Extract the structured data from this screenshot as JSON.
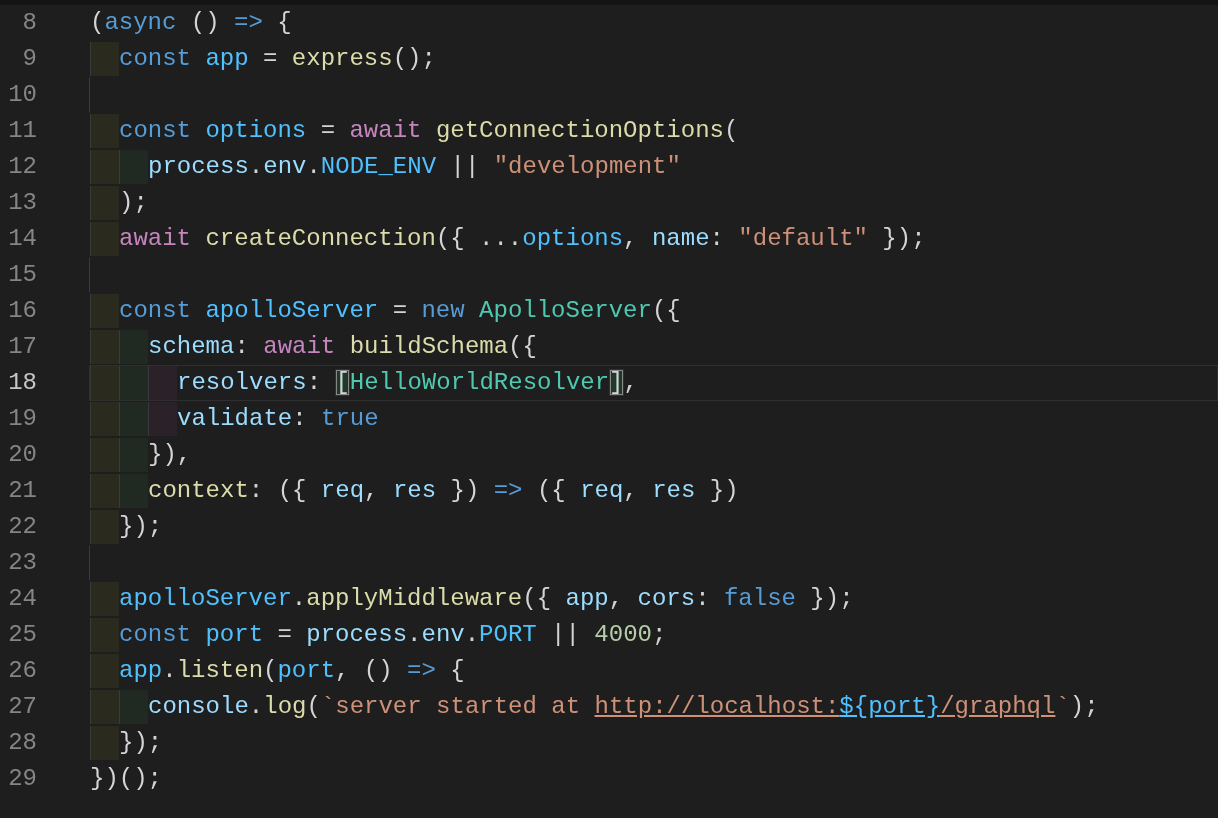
{
  "lines": [
    {
      "number": "8",
      "current": false,
      "tokens": [
        {
          "kind": "p",
          "text": "("
        },
        {
          "kind": "kw",
          "text": "async"
        },
        {
          "kind": "p",
          "text": " () "
        },
        {
          "kind": "kw",
          "text": "=>"
        },
        {
          "kind": "p",
          "text": " {"
        }
      ]
    },
    {
      "number": "9",
      "current": false,
      "tokens": [
        {
          "kind": "kw",
          "text": "  const "
        },
        {
          "kind": "const",
          "text": "app"
        },
        {
          "kind": "p",
          "text": " = "
        },
        {
          "kind": "fn",
          "text": "express"
        },
        {
          "kind": "p",
          "text": "();"
        }
      ]
    },
    {
      "number": "10",
      "current": false
    },
    {
      "number": "11",
      "current": false,
      "tokens": [
        {
          "kind": "kw",
          "text": "  const "
        },
        {
          "kind": "const",
          "text": "options"
        },
        {
          "kind": "p",
          "text": " = "
        },
        {
          "kind": "await",
          "text": "await "
        },
        {
          "kind": "fn",
          "text": "getConnectionOptions"
        },
        {
          "kind": "p",
          "text": "("
        }
      ]
    },
    {
      "number": "12",
      "current": false,
      "tokens": [
        {
          "kind": "var",
          "text": "    process"
        },
        {
          "kind": "p",
          "text": "."
        },
        {
          "kind": "var",
          "text": "env"
        },
        {
          "kind": "p",
          "text": "."
        },
        {
          "kind": "const",
          "text": "NODE_ENV"
        },
        {
          "kind": "p",
          "text": " || "
        },
        {
          "kind": "str",
          "text": "\"development\""
        }
      ]
    },
    {
      "number": "13",
      "current": false,
      "tokens": [
        {
          "kind": "p",
          "text": "  );"
        }
      ]
    },
    {
      "number": "14",
      "current": false,
      "tokens": [
        {
          "kind": "await",
          "text": "  await "
        },
        {
          "kind": "fn",
          "text": "createConnection"
        },
        {
          "kind": "p",
          "text": "({ ..."
        },
        {
          "kind": "const",
          "text": "options"
        },
        {
          "kind": "p",
          "text": ", "
        },
        {
          "kind": "var",
          "text": "name"
        },
        {
          "kind": "p",
          "text": ": "
        },
        {
          "kind": "str",
          "text": "\"default\""
        },
        {
          "kind": "p",
          "text": " });"
        }
      ]
    },
    {
      "number": "15",
      "current": false
    },
    {
      "number": "16",
      "current": false,
      "tokens": [
        {
          "kind": "kw",
          "text": "  const "
        },
        {
          "kind": "const",
          "text": "apolloServer"
        },
        {
          "kind": "p",
          "text": " = "
        },
        {
          "kind": "kw",
          "text": "new "
        },
        {
          "kind": "cls",
          "text": "ApolloServer"
        },
        {
          "kind": "p",
          "text": "({"
        }
      ]
    },
    {
      "number": "17",
      "current": false,
      "tokens": [
        {
          "kind": "var",
          "text": "    schema"
        },
        {
          "kind": "p",
          "text": ": "
        },
        {
          "kind": "await",
          "text": "await "
        },
        {
          "kind": "fn",
          "text": "buildSchema"
        },
        {
          "kind": "p",
          "text": "({"
        }
      ]
    },
    {
      "number": "18",
      "current": true,
      "tokens": [
        {
          "kind": "var",
          "text": "      resolvers"
        },
        {
          "kind": "p",
          "text": ": "
        },
        {
          "kind": "match",
          "text": "["
        },
        {
          "kind": "cls",
          "text": "HelloWorldResolver"
        },
        {
          "kind": "match",
          "text": "]"
        },
        {
          "kind": "p",
          "text": ","
        }
      ]
    },
    {
      "number": "19",
      "current": false,
      "tokens": [
        {
          "kind": "var",
          "text": "      validate"
        },
        {
          "kind": "p",
          "text": ": "
        },
        {
          "kind": "kw",
          "text": "true"
        }
      ]
    },
    {
      "number": "20",
      "current": false,
      "tokens": [
        {
          "kind": "p",
          "text": "    }),"
        }
      ]
    },
    {
      "number": "21",
      "current": false,
      "tokens": [
        {
          "kind": "fn",
          "text": "    context"
        },
        {
          "kind": "p",
          "text": ": ({ "
        },
        {
          "kind": "var",
          "text": "req"
        },
        {
          "kind": "p",
          "text": ", "
        },
        {
          "kind": "var",
          "text": "res"
        },
        {
          "kind": "p",
          "text": " }) "
        },
        {
          "kind": "kw",
          "text": "=>"
        },
        {
          "kind": "p",
          "text": " ({ "
        },
        {
          "kind": "var",
          "text": "req"
        },
        {
          "kind": "p",
          "text": ", "
        },
        {
          "kind": "var",
          "text": "res"
        },
        {
          "kind": "p",
          "text": " })"
        }
      ]
    },
    {
      "number": "22",
      "current": false,
      "tokens": [
        {
          "kind": "p",
          "text": "  });"
        }
      ]
    },
    {
      "number": "23",
      "current": false
    },
    {
      "number": "24",
      "current": false,
      "tokens": [
        {
          "kind": "const",
          "text": "  apolloServer"
        },
        {
          "kind": "p",
          "text": "."
        },
        {
          "kind": "fn",
          "text": "applyMiddleware"
        },
        {
          "kind": "p",
          "text": "({ "
        },
        {
          "kind": "var",
          "text": "app"
        },
        {
          "kind": "p",
          "text": ", "
        },
        {
          "kind": "var",
          "text": "cors"
        },
        {
          "kind": "p",
          "text": ": "
        },
        {
          "kind": "kw",
          "text": "false"
        },
        {
          "kind": "p",
          "text": " });"
        }
      ]
    },
    {
      "number": "25",
      "current": false,
      "tokens": [
        {
          "kind": "kw",
          "text": "  const "
        },
        {
          "kind": "const",
          "text": "port"
        },
        {
          "kind": "p",
          "text": " = "
        },
        {
          "kind": "var",
          "text": "process"
        },
        {
          "kind": "p",
          "text": "."
        },
        {
          "kind": "var",
          "text": "env"
        },
        {
          "kind": "p",
          "text": "."
        },
        {
          "kind": "const",
          "text": "PORT"
        },
        {
          "kind": "p",
          "text": " || "
        },
        {
          "kind": "num",
          "text": "4000"
        },
        {
          "kind": "p",
          "text": ";"
        }
      ]
    },
    {
      "number": "26",
      "current": false,
      "tokens": [
        {
          "kind": "const",
          "text": "  app"
        },
        {
          "kind": "p",
          "text": "."
        },
        {
          "kind": "fn",
          "text": "listen"
        },
        {
          "kind": "p",
          "text": "("
        },
        {
          "kind": "const",
          "text": "port"
        },
        {
          "kind": "p",
          "text": ", () "
        },
        {
          "kind": "kw",
          "text": "=>"
        },
        {
          "kind": "p",
          "text": " {"
        }
      ]
    },
    {
      "number": "27",
      "current": false,
      "tokens": [
        {
          "kind": "var",
          "text": "    console"
        },
        {
          "kind": "p",
          "text": "."
        },
        {
          "kind": "fn",
          "text": "log"
        },
        {
          "kind": "p",
          "text": "("
        },
        {
          "kind": "str",
          "text": "`server started at "
        },
        {
          "kind": "link",
          "text": "http://localhost:"
        },
        {
          "kind": "linkvar",
          "text": "${port}"
        },
        {
          "kind": "link",
          "text": "/graphql"
        },
        {
          "kind": "str",
          "text": "`"
        },
        {
          "kind": "p",
          "text": ");"
        }
      ]
    },
    {
      "number": "28",
      "current": false,
      "tokens": [
        {
          "kind": "p",
          "text": "  });"
        }
      ]
    },
    {
      "number": "29",
      "current": false,
      "tokens": [
        {
          "kind": "p",
          "text": "})();"
        }
      ]
    }
  ]
}
